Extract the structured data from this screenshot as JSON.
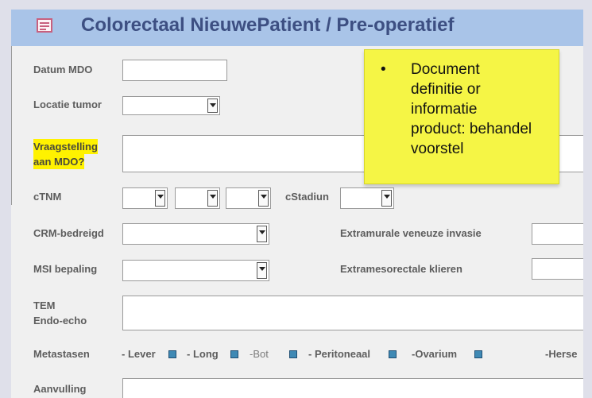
{
  "window": {
    "title": "Colorectaal   NieuwePatient / Pre-operatief",
    "icon": "form-icon"
  },
  "form": {
    "datum_mdo_label": "Datum MDO",
    "locatie_tumor_label": "Locatie tumor",
    "vraagstelling_label_line1": "Vraagstelling",
    "vraagstelling_label_line2": "aan MDO?",
    "ctnm_label": "cTNM",
    "cstadium_label": "cStadiun",
    "crm_label": "CRM-bedreigd",
    "extramurale_label": "Extramurale veneuze invasie",
    "msi_label": "MSI bepaling",
    "extramesorectale_label": "Extramesorectale klieren",
    "tem_label_line1": "TEM",
    "tem_label_line2": "Endo-echo",
    "metastasen_label": "Metastasen",
    "metastasen_options": [
      "- Lever",
      "- Long",
      "-Bot",
      "- Peritoneaal",
      "-Ovarium",
      "-Herse"
    ],
    "aanvulling_label": "Aanvulling"
  },
  "note": {
    "bullet": "•",
    "text_lines": [
      "Document",
      "definitie or",
      "informatie",
      "product: behandel",
      "voorstel"
    ]
  },
  "colors": {
    "header_bg": "#a9c4e8",
    "title": "#3d4f82",
    "highlight": "#fff200",
    "sticky_note": "#f5f545",
    "checkbox": "#3f89b4"
  }
}
